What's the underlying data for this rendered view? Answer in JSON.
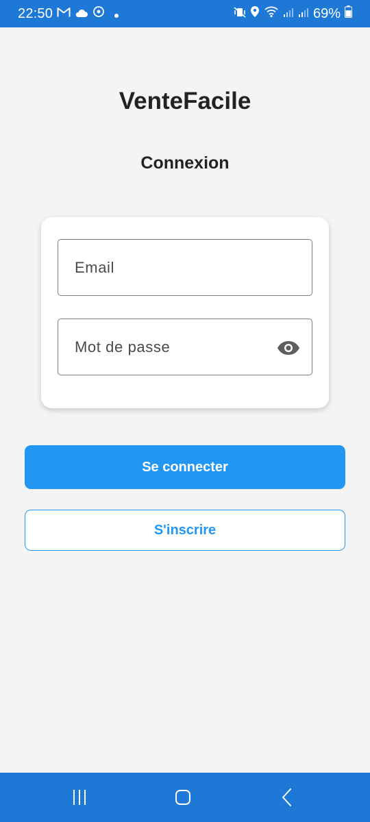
{
  "status_bar": {
    "time": "22:50",
    "battery_percent": "69%",
    "battery_level": 0.69,
    "icons_left": [
      "gmail-icon",
      "cloud-icon",
      "sync-icon",
      "dot-icon"
    ],
    "icons_right": [
      "vibrate-icon",
      "location-icon",
      "wifi-icon",
      "signal-icon",
      "signal-icon",
      "battery-icon"
    ]
  },
  "app": {
    "title": "VenteFacile"
  },
  "screen": {
    "title": "Connexion"
  },
  "form": {
    "email_placeholder": "Email",
    "email_value": "",
    "password_placeholder": "Mot de passe",
    "password_value": "",
    "password_toggle_icon": "eye-icon"
  },
  "buttons": {
    "login_label": "Se connecter",
    "signup_label": "S'inscrire"
  },
  "nav_bar": {
    "icons": [
      "recents-icon",
      "home-icon",
      "back-icon"
    ]
  },
  "colors": {
    "status_bar": "#1e78d6",
    "nav_bar": "#1e78d6",
    "primary": "#2196f3",
    "background": "#f4f4f4",
    "title_text": "#222222"
  }
}
